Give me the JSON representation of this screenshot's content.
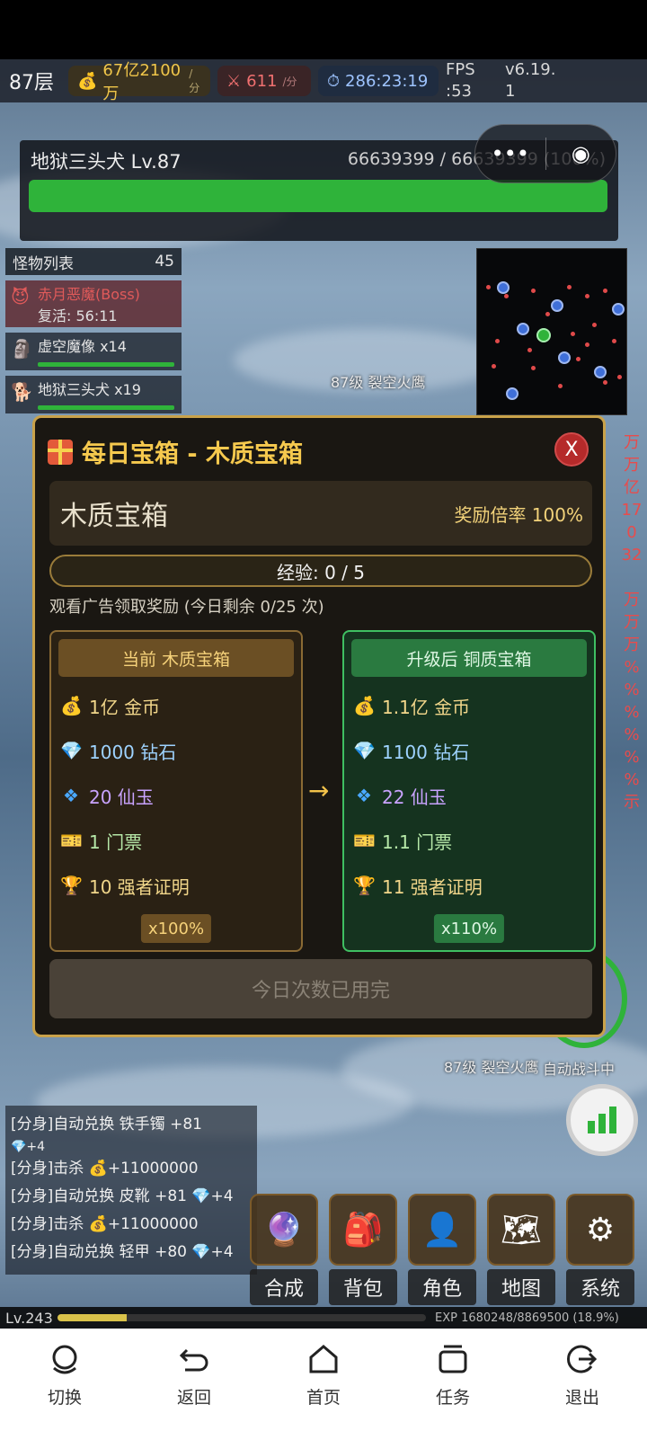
{
  "hud": {
    "floor": "87层",
    "gold_rate": "67亿2100万",
    "gold_unit": "/分",
    "attack_rate": "611",
    "attack_unit": "/分",
    "timer": "286:23:19",
    "fps_label": "FPS",
    "fps_value": ":53",
    "version_line1": "v6.19.",
    "version_line2": "1"
  },
  "boss": {
    "name": "地狱三头犬 Lv.87",
    "hp_text": "66639399 / 66639399 (100%)",
    "hp_fraction": 1.0
  },
  "monster_list": {
    "title": "怪物列表",
    "count": "45",
    "items": [
      {
        "name": "赤月恶魔(Boss)",
        "sub": "复活: 56:11"
      },
      {
        "name": "虚空魔像 x14"
      },
      {
        "name": "地狱三头犬 x19"
      }
    ]
  },
  "field_labels": {
    "enemy_top": "87级 裂空火鹰",
    "enemy_bottom": "87级 裂空火鹰",
    "auto_battle": "自动战斗中"
  },
  "modal": {
    "title": "每日宝箱 - 木质宝箱",
    "close": "X",
    "chest_name": "木质宝箱",
    "reward_rate": "奖励倍率 100%",
    "exp_text": "经验: 0 / 5",
    "exp_fraction": 0,
    "ad_note": "观看广告领取奖励 (今日剩余 0/25 次)",
    "current": {
      "header": "当前 木质宝箱",
      "rewards": [
        "1亿 金币",
        "1000 钻石",
        "20 仙玉",
        "1 门票",
        "10 强者证明"
      ],
      "multiplier": "x100%"
    },
    "upgraded": {
      "header": "升级后 铜质宝箱",
      "rewards": [
        "1.1亿 金币",
        "1100 钻石",
        "22 仙玉",
        "1.1 门票",
        "11 强者证明"
      ],
      "multiplier": "x110%"
    },
    "arrow": "→",
    "claim_button": "今日次数已用完"
  },
  "log": [
    "[分身]自动兑换 铁手镯 +81",
    "💎+4",
    "[分身]击杀 💰+11000000",
    "[分身]自动兑换 皮靴 +81 💎+4",
    "[分身]击杀 💰+11000000",
    "[分身]自动兑换 轻甲 +80 💎+4"
  ],
  "menu": [
    "合成",
    "背包",
    "角色",
    "地图",
    "系统"
  ],
  "player": {
    "level": "Lv.243",
    "exp_text": "EXP 1680248/8869500 (18.9%)",
    "exp_fraction": 0.189
  },
  "nav": [
    "切换",
    "返回",
    "首页",
    "任务",
    "退出"
  ],
  "side_values": [
    "万",
    "万",
    "亿",
    "17",
    "0",
    "32",
    "",
    "万",
    "万",
    "万",
    "%",
    "%",
    "%",
    "%",
    "%",
    "%",
    "示"
  ],
  "icons": {
    "reward_icons": [
      "money-bag-icon",
      "diamond-icon",
      "jade-icon",
      "ticket-icon",
      "trophy-icon"
    ],
    "menu_icons": [
      "crystal-ball-icon",
      "backpack-icon",
      "character-icon",
      "map-icon",
      "gear-icon"
    ],
    "nav_icons": [
      "switch-icon",
      "back-icon",
      "home-icon",
      "task-icon",
      "exit-icon"
    ]
  },
  "colors": {
    "accent_gold": "#f6c94e",
    "hp_green": "#2fb33a",
    "close_red": "#b52a2a"
  }
}
